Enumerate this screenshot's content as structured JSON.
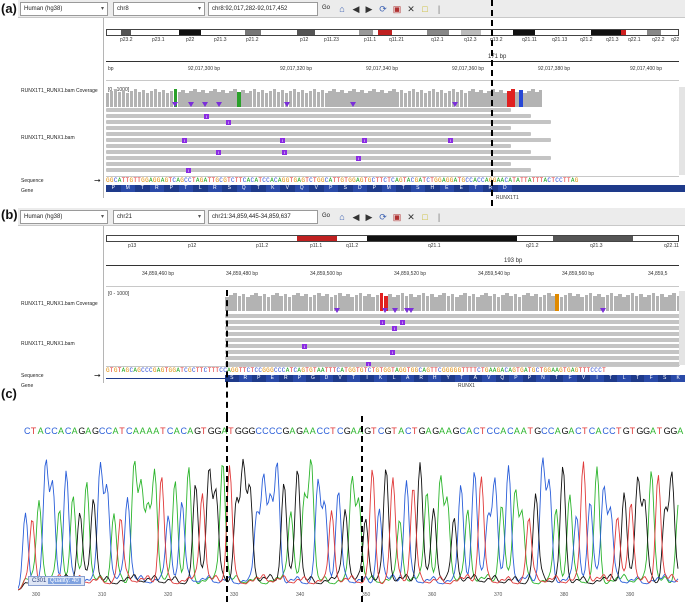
{
  "panels": {
    "a": "(a)",
    "b": "(b)",
    "c": "(c)"
  },
  "igv_a": {
    "genome": "Human (hg38)",
    "chromosome": "chr8",
    "locus": "chr8:92,017,282-92,017,452",
    "go_label": "Go",
    "bands": [
      "p23.2",
      "p23.1",
      "p22",
      "p21.3",
      "p21.2",
      "p12",
      "p11.23",
      "p11.1",
      "q11.21",
      "q12.1",
      "q12.3",
      "q13.2",
      "q21.11",
      "q21.13",
      "q21.2",
      "q21.3",
      "q22.1",
      "q22.2",
      "q22"
    ],
    "span": "171 bp",
    "ruler_unit": "bp",
    "ruler_ticks": [
      "92,017,300 bp",
      "92,017,320 bp",
      "92,017,340 bp",
      "92,017,360 bp",
      "92,017,380 bp",
      "92,017,400 bp"
    ],
    "coverage_label": "RUNX1T1_RUNX1.bam Coverage",
    "coverage_range": "[0 - 1000]",
    "bam_label": "RUNX1T1_RUNX1.bam",
    "sequence_label": "Sequence",
    "gene_label": "Gene",
    "sequence": "GGCATTGTTGGAGGAGTCAGCCTAGATTGCGTCTTCACATCCACAGGTGAGTCTGGCATTGTGGAGTGCTTCTCAGTACGATCTGGAGGATGCCACCAGGAACATATTATTTACTCCTTAG",
    "amino_acids": [
      "P",
      "M",
      "T",
      "R",
      "P",
      "T",
      "L",
      "R",
      "S",
      "Q",
      "T",
      "K",
      "V",
      "Q",
      "V",
      "P",
      "S",
      "D",
      "P",
      "M",
      "T",
      "S",
      "H",
      "E",
      "E",
      "T",
      "R",
      "D"
    ],
    "gene_name": "RUNX1T1"
  },
  "igv_b": {
    "genome": "Human (hg38)",
    "chromosome": "chr21",
    "locus": "chr21:34,859,445-34,859,637",
    "go_label": "Go",
    "bands": [
      "p13",
      "p12",
      "p11.2",
      "p11.1",
      "q11.2",
      "q21.1",
      "q21.2",
      "q21.3",
      "q22.11"
    ],
    "span": "193 bp",
    "ruler_ticks": [
      "34,859,460 bp",
      "34,859,480 bp",
      "34,859,500 bp",
      "34,859,520 bp",
      "34,859,540 bp",
      "34,859,560 bp",
      "34,859,5"
    ],
    "coverage_label": "RUNX1T1_RUNX1.bam Coverage",
    "coverage_range": "[0 - 1000]",
    "bam_label": "RUNX1T1_RUNX1.bam",
    "sequence_label": "Sequence",
    "gene_label": "Gene",
    "sequence": "GTGTAGCAGCCCGAGTGGATCGCTTCTTTCCAGGTTCTCCGGGCCCATCAGTGTAATTTCATGGTGTCTGTGGTAGGTGGCAGTTCGGGGGTTTTCTGAAGACAGTGATGCTGGAAGTGAGTTTCCCT",
    "amino_acids": [
      "S",
      "R",
      "P",
      "E",
      "R",
      "P",
      "G",
      "D",
      "V",
      "T",
      "I",
      "K",
      "L",
      "A",
      "R",
      "H",
      "Y",
      "T",
      "A",
      "V",
      "Q",
      "P",
      "P",
      "N",
      "T",
      "F",
      "V",
      "I",
      "T",
      "L",
      "T",
      "F",
      "S",
      "K"
    ],
    "gene_name": "RUNX1"
  },
  "trace": {
    "bases": "CTACCACAGAGCCATCAAAATCACAGTGGATGGGCCCCGAGAACCTCGAAGTCGTACTGAGAAGCACTCCACAATGCCAGACTCACCTGTGGATGGA",
    "badge_prefix": "C301",
    "badge_detail": "Quality: 40",
    "axis_ticks": [
      "300",
      "310",
      "320",
      "330",
      "340",
      "350",
      "360",
      "370",
      "380",
      "390"
    ]
  },
  "colors": {
    "A": "#22a722",
    "C": "#2747d6",
    "G": "#e08a00",
    "T": "#e02020",
    "trace_A": "#2db52d",
    "trace_C": "#2b5fd9",
    "trace_G": "#111111",
    "trace_T": "#e03a3a",
    "insertion": "#8a2be2",
    "read": "#c4c4c4",
    "coverage": "#b3b3b3",
    "aa_track": "#1e3a8a"
  }
}
